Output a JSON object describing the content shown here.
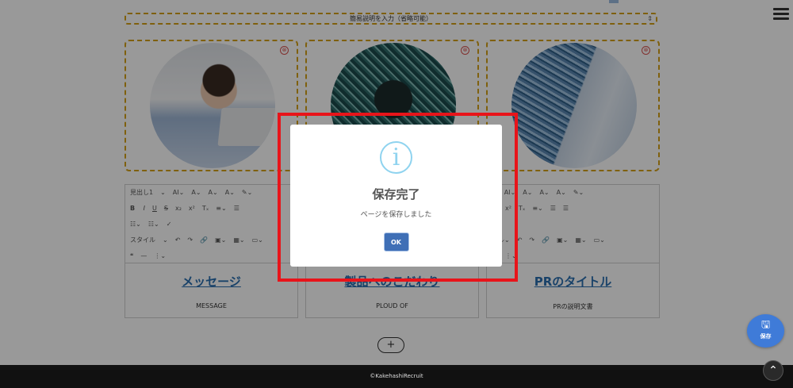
{
  "header": {
    "description_select": "簡易説明を入力（省略可能）"
  },
  "cards": [
    {
      "remove_label": "⊗",
      "image": "woman-with-laptop-photo"
    },
    {
      "remove_label": "⊗",
      "image": "circuit-board-photo"
    },
    {
      "remove_label": "⊗",
      "image": "circuit-city-photo"
    }
  ],
  "editor": {
    "heading_select": "見出し1",
    "style_select": "スタイル"
  },
  "content_blocks": [
    {
      "title": "メッセージ",
      "subtitle": "MESSAGE"
    },
    {
      "title": "製品へのこだわり",
      "subtitle": "PLOUD OF"
    },
    {
      "title": "PRのタイトル",
      "subtitle": "PRの説明文書"
    }
  ],
  "add_button": "+",
  "footer": {
    "copyright": "©KakehashiRecruit"
  },
  "save_fab": {
    "label": "保存"
  },
  "modal": {
    "title": "保存完了",
    "message": "ページを保存しました",
    "ok_label": "OK"
  },
  "colors": {
    "accent_blue": "#3f6fb6",
    "dashed_border": "#d4a017",
    "highlight_red": "#e8141a",
    "info_icon": "#8fd3ef"
  }
}
